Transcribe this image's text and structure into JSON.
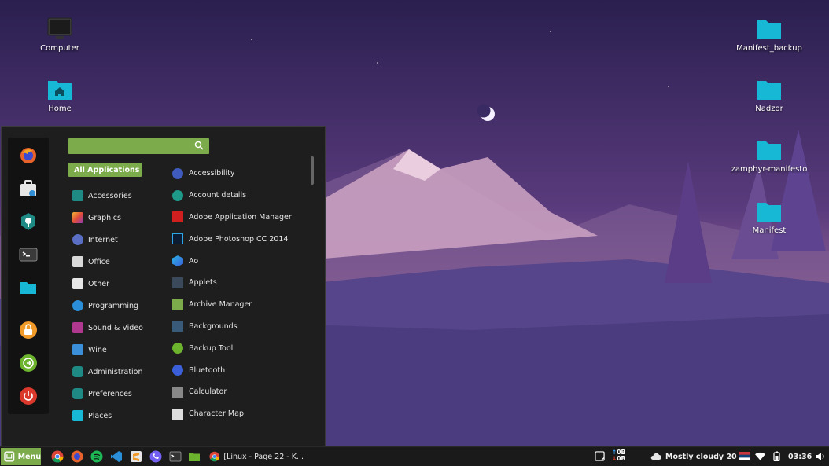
{
  "desktop": {
    "icons_left": [
      {
        "label": "Computer",
        "icon": "monitor-icon"
      },
      {
        "label": "Home",
        "icon": "home-folder-icon"
      }
    ],
    "icons_right": [
      {
        "label": "Manifest_backup",
        "icon": "folder-icon"
      },
      {
        "label": "Nadzor",
        "icon": "folder-icon"
      },
      {
        "label": "zamphyr-manifesto",
        "icon": "folder-icon"
      },
      {
        "label": "Manifest",
        "icon": "folder-icon"
      }
    ]
  },
  "menu": {
    "favorites": [
      "firefox-icon",
      "software-manager-icon",
      "system-settings-icon",
      "terminal-icon",
      "files-icon",
      "lock-screen-icon",
      "logout-icon",
      "shutdown-icon"
    ],
    "search": {
      "value": "",
      "placeholder": ""
    },
    "categories": [
      {
        "label": "All Applications",
        "icon": "all-apps-icon",
        "active": true
      },
      {
        "label": "Accessories",
        "icon": "accessories-icon"
      },
      {
        "label": "Graphics",
        "icon": "graphics-icon"
      },
      {
        "label": "Internet",
        "icon": "internet-icon"
      },
      {
        "label": "Office",
        "icon": "office-icon"
      },
      {
        "label": "Other",
        "icon": "other-icon"
      },
      {
        "label": "Programming",
        "icon": "programming-icon"
      },
      {
        "label": "Sound & Video",
        "icon": "sound-video-icon"
      },
      {
        "label": "Wine",
        "icon": "wine-icon"
      },
      {
        "label": "Administration",
        "icon": "administration-icon"
      },
      {
        "label": "Preferences",
        "icon": "preferences-icon"
      },
      {
        "label": "Places",
        "icon": "places-icon"
      }
    ],
    "apps": [
      {
        "label": "Accessibility",
        "icon": "accessibility-icon"
      },
      {
        "label": "Account details",
        "icon": "account-icon"
      },
      {
        "label": "Adobe Application Manager",
        "icon": "adobe-icon"
      },
      {
        "label": "Adobe Photoshop CC 2014",
        "icon": "photoshop-icon"
      },
      {
        "label": "Ao",
        "icon": "ao-icon"
      },
      {
        "label": "Applets",
        "icon": "applets-icon"
      },
      {
        "label": "Archive Manager",
        "icon": "archive-icon"
      },
      {
        "label": "Backgrounds",
        "icon": "backgrounds-icon"
      },
      {
        "label": "Backup Tool",
        "icon": "backup-icon"
      },
      {
        "label": "Bluetooth",
        "icon": "bluetooth-icon"
      },
      {
        "label": "Calculator",
        "icon": "calculator-icon"
      },
      {
        "label": "Character Map",
        "icon": "character-map-icon"
      }
    ]
  },
  "taskbar": {
    "menu_label": "Menu",
    "launchers": [
      "chrome-icon",
      "firefox-icon",
      "spotify-icon",
      "vscode-icon",
      "sublime-icon",
      "viber-icon",
      "terminal-icon",
      "files-icon"
    ],
    "window_title": "[Linux - Page 22 - K...",
    "net_up": "0B",
    "net_down": "0B",
    "weather": "Mostly cloudy 20 °C",
    "clock": "03:36"
  },
  "colors": {
    "accent": "#7cab4b",
    "folder": "#17b7d6",
    "panel": "#1e1e1e",
    "taskbar": "#1a1a1a"
  }
}
